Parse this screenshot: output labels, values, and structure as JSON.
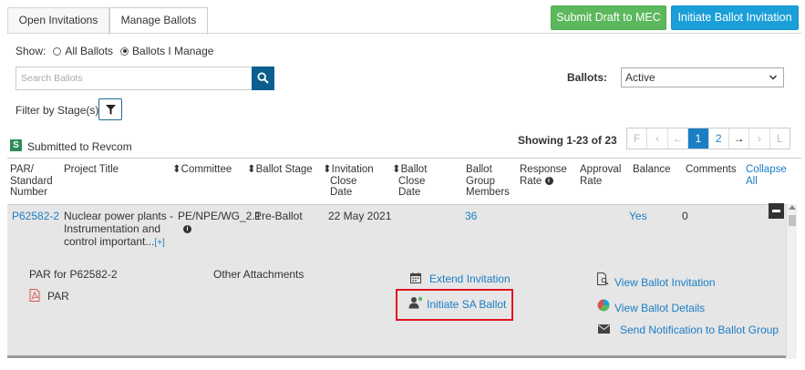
{
  "tabs": [
    {
      "label": "Open Invitations"
    },
    {
      "label": "Manage Ballots"
    }
  ],
  "actions": {
    "submit_draft": "Submit Draft to MEC",
    "initiate_invitation": "Initiate Ballot Invitation"
  },
  "show": {
    "label": "Show:",
    "options": [
      "All Ballots",
      "Ballots I Manage"
    ],
    "selected": "Ballots I Manage"
  },
  "search": {
    "placeholder": "Search Ballots"
  },
  "ballots_filter": {
    "label": "Ballots:",
    "value": "Active"
  },
  "filter_stage": {
    "label": "Filter by Stage(s)"
  },
  "status": {
    "badge": "S",
    "label": "Submitted to Revcom"
  },
  "showing": "Showing 1-23 of 23",
  "pager": [
    "F",
    "‹",
    "←",
    "1",
    "2",
    "→",
    "›",
    "L"
  ],
  "columns": {
    "par": [
      "PAR/",
      "Standard",
      "Number"
    ],
    "title": [
      "Project Title"
    ],
    "committee": [
      "⬍Committee"
    ],
    "stage": [
      "⬍Ballot Stage"
    ],
    "inv_close": [
      "⬍Invitation",
      "Close",
      "Date"
    ],
    "ballot_close": [
      "⬍Ballot",
      "Close",
      "Date"
    ],
    "members": [
      "Ballot",
      "Group",
      "Members"
    ],
    "response": [
      "Response",
      "Rate"
    ],
    "approval": [
      "Approval",
      "Rate"
    ],
    "balance": [
      "Balance"
    ],
    "comments": [
      "Comments"
    ],
    "collapse": [
      "Collapse",
      "All"
    ]
  },
  "row": {
    "par": "P62582-2",
    "title": [
      "Nuclear power plants -",
      "Instrumentation and",
      "control important..."
    ],
    "more": "[+]",
    "committee": "PE/NPE/WG_2.1",
    "stage": "Pre-Ballot",
    "inv_close": "22 May 2021",
    "members": "36",
    "balance": "Yes",
    "comments": "0"
  },
  "detail": {
    "par_for": "PAR for P62582-2",
    "par_file": "PAR",
    "other_attachments": "Other Attachments",
    "extend": "Extend Invitation",
    "initiate_sa": "Initiate SA Ballot",
    "view_invitation": "View Ballot Invitation",
    "view_details": "View Ballot Details",
    "send_notification": "Send Notification to Ballot Group"
  },
  "colors": {
    "accent": "#1a7ec4",
    "green": "#5cb85c",
    "blue": "#1a9fd9",
    "highlight": "#e0141e"
  }
}
